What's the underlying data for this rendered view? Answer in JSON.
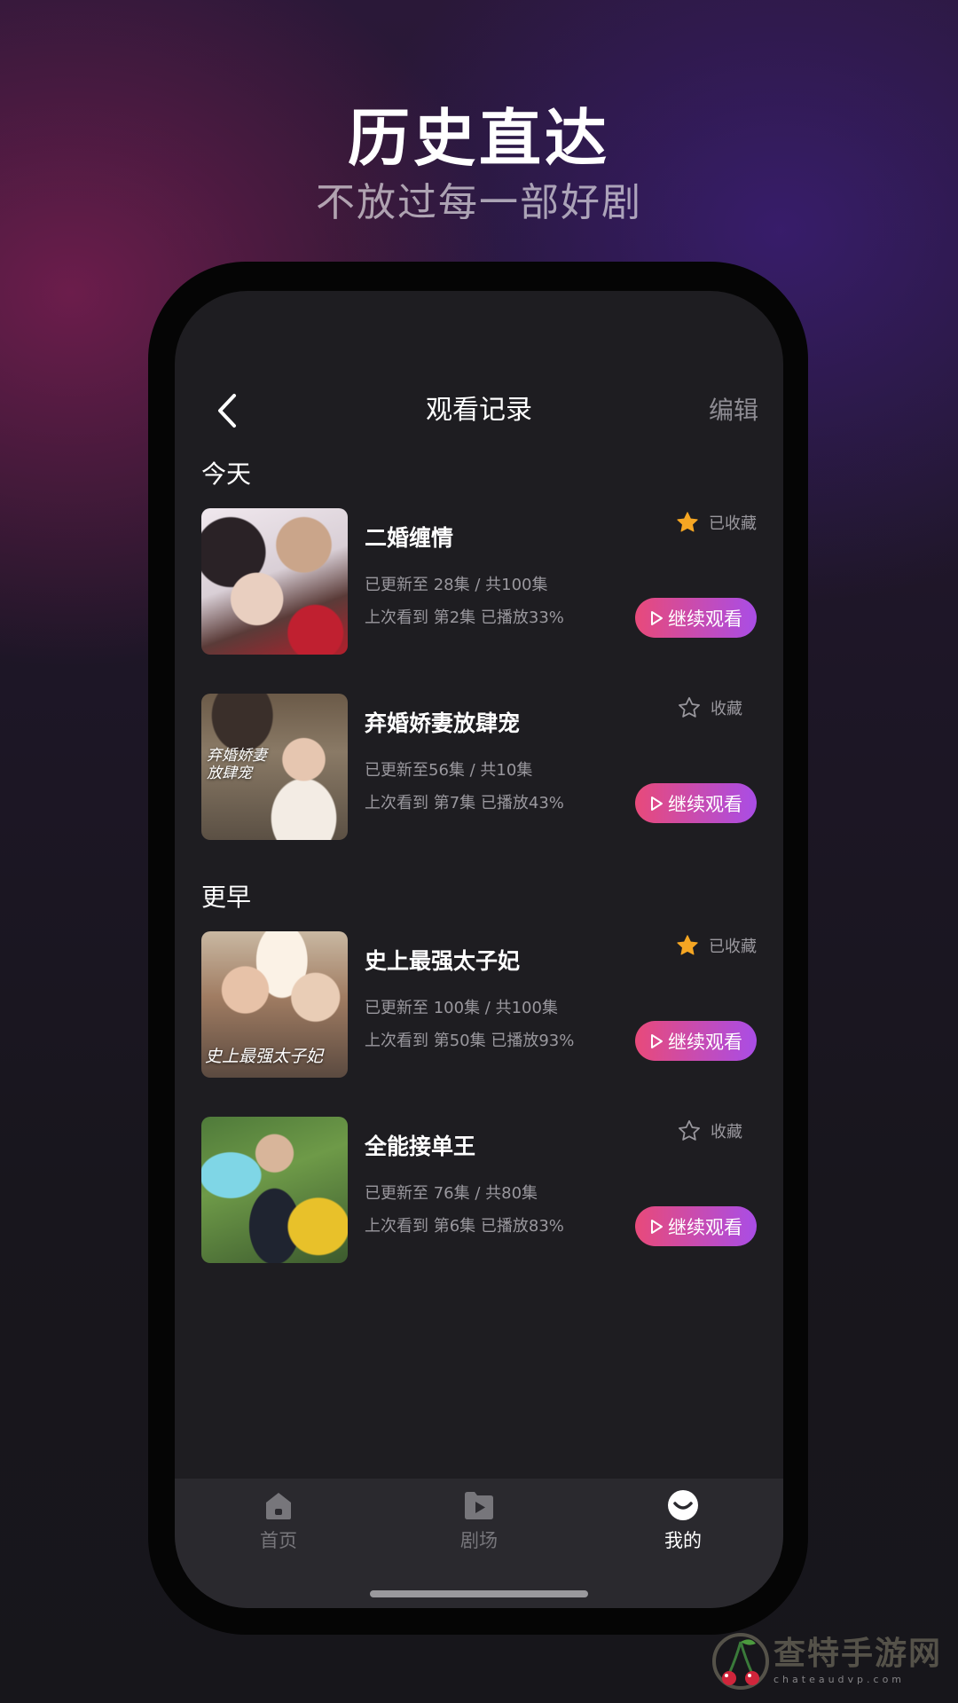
{
  "promo": {
    "headline": "历史直达",
    "subline": "不放过每一部好剧"
  },
  "nav": {
    "title": "观看记录",
    "edit_label": "编辑",
    "back_icon": "chevron-left-icon"
  },
  "sections": {
    "today": "今天",
    "earlier": "更早"
  },
  "items": [
    {
      "title": "二婚缠情",
      "updated": "已更新至 28集 / 共100集",
      "progress": "上次看到 第2集 已播放33%",
      "favorited": true,
      "fav_label": "已收藏",
      "continue_label": "继续观看",
      "poster_caption": ""
    },
    {
      "title": "弃婚娇妻放肆宠",
      "updated": "已更新至56集 / 共10集",
      "progress": "上次看到 第7集 已播放43%",
      "favorited": false,
      "fav_label": "收藏",
      "continue_label": "继续观看",
      "poster_caption": "弃婚娇妻放肆宠"
    },
    {
      "title": "史上最强太子妃",
      "updated": "已更新至 100集 / 共100集",
      "progress": "上次看到 第50集 已播放93%",
      "favorited": true,
      "fav_label": "已收藏",
      "continue_label": "继续观看",
      "poster_caption": "史上最强太子妃"
    },
    {
      "title": "全能接单王",
      "updated": "已更新至 76集 / 共80集",
      "progress": "上次看到 第6集 已播放83%",
      "favorited": false,
      "fav_label": "收藏",
      "continue_label": "继续观看",
      "poster_caption": ""
    }
  ],
  "tabbar": {
    "tabs": [
      {
        "label": "首页",
        "icon": "home-icon",
        "active": false
      },
      {
        "label": "剧场",
        "icon": "play-folder-icon",
        "active": false
      },
      {
        "label": "我的",
        "icon": "smile-icon",
        "active": true
      }
    ]
  },
  "watermark": {
    "title": "查特手游网",
    "url": "chateaudvp.com"
  },
  "colors": {
    "accent_start": "#e84a7a",
    "accent_end": "#a94de6",
    "star_filled": "#f5a623",
    "screen_bg": "#1e1d21"
  }
}
